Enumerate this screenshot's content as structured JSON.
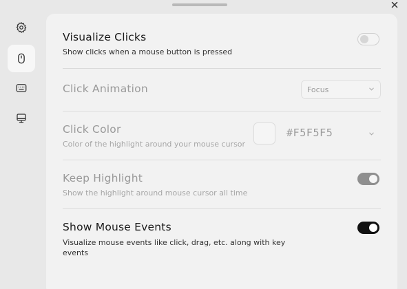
{
  "window": {
    "close_icon": "close-icon",
    "drag_handle": "drag-handle"
  },
  "sidebar": {
    "items": [
      {
        "name": "settings",
        "icon": "gear-icon",
        "active": false
      },
      {
        "name": "mouse",
        "icon": "mouse-icon",
        "active": true
      },
      {
        "name": "keyboard",
        "icon": "keyboard-icon",
        "active": false
      },
      {
        "name": "display",
        "icon": "monitor-icon",
        "active": false
      }
    ]
  },
  "settings": {
    "visualize_clicks": {
      "title": "Visualize Clicks",
      "description": "Show clicks when a mouse button is pressed",
      "enabled": false
    },
    "click_animation": {
      "title": "Click Animation",
      "value": "Focus"
    },
    "click_color": {
      "title": "Click Color",
      "description": "Color of the highlight around your mouse cursor",
      "hex": "#F5F5F5",
      "swatch_color": "#F5F5F5"
    },
    "keep_highlight": {
      "title": "Keep Highlight",
      "description": "Show the highlight around mouse cursor all time",
      "enabled": true
    },
    "show_mouse_events": {
      "title": "Show Mouse Events",
      "description_line1": "Visualize mouse events like click, drag, etc. along with key",
      "description_line2": "events",
      "enabled": true
    }
  }
}
